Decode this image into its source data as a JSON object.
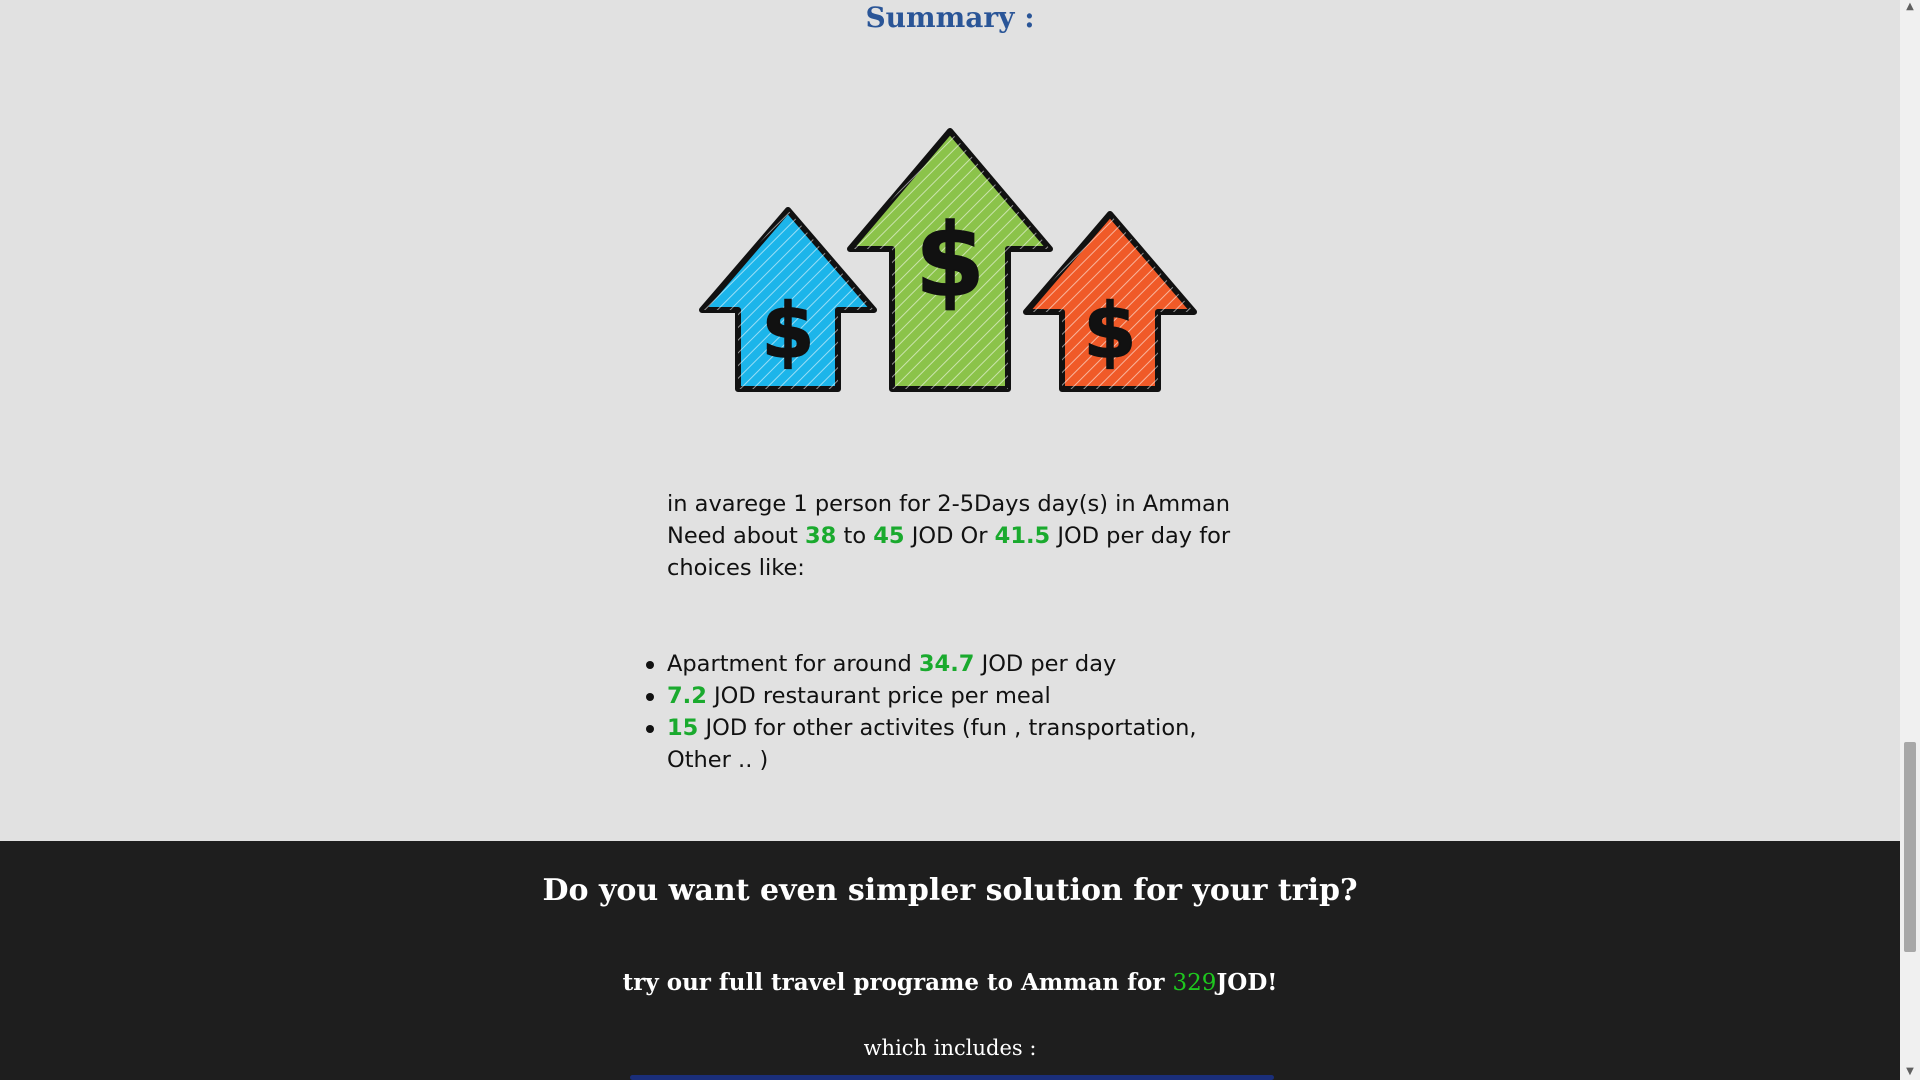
{
  "summary": {
    "title": "Summary :",
    "illustration": {
      "arrows": [
        {
          "color": "#1cb5ea",
          "icon": "dollar-icon"
        },
        {
          "color": "#8bc34a",
          "icon": "dollar-icon"
        },
        {
          "color": "#f05a28",
          "icon": "dollar-icon"
        }
      ]
    },
    "info": {
      "line1": "in avarege 1 person for 2-5Days day(s) in Amman",
      "need_prefix": "Need about",
      "min": "38",
      "to": "to",
      "max": "45",
      "currency_or": "JOD Or",
      "per_day": "41.5",
      "suffix": "JOD per day for choices like:"
    },
    "costs": [
      {
        "prefix": "Apartment for around",
        "value": "34.7",
        "suffix": "JOD per day"
      },
      {
        "prefix": "",
        "value": "7.2",
        "suffix": "JOD restaurant price per meal"
      },
      {
        "prefix": "",
        "value": "15",
        "suffix": "JOD for other activites (fun , transportation, Other .. )"
      }
    ]
  },
  "promo": {
    "heading": "Do you want even simpler solution for your trip?",
    "offer_prefix": "try our full travel programe to Amman for",
    "price": "329",
    "offer_suffix": "JOD!",
    "includes": "which includes :"
  },
  "colors": {
    "title_blue": "#2a5597",
    "highlight_green": "#1aaa2e",
    "footer_bg": "#1e1e1e",
    "page_bg": "#e1e1e1"
  }
}
